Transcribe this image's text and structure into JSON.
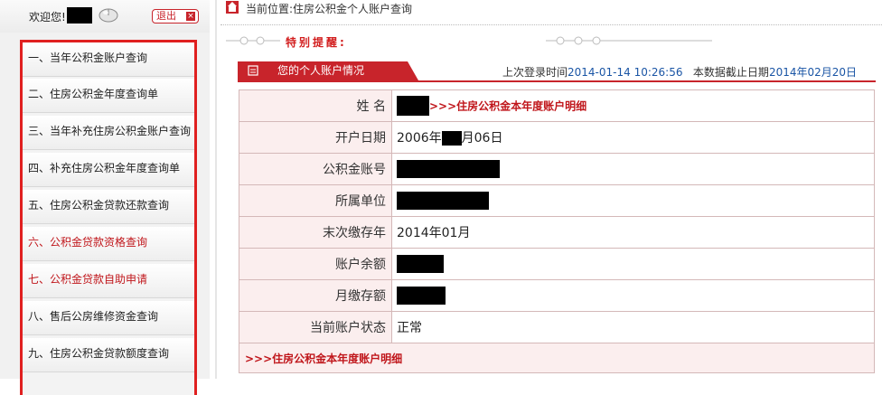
{
  "welcome": {
    "text": "欢迎您!",
    "logout_label": "退出"
  },
  "menu": [
    {
      "label": "一、当年公积金账户查询",
      "highlight": false
    },
    {
      "label": "二、住房公积金年度查询单",
      "highlight": false
    },
    {
      "label": "三、当年补充住房公积金账户查询",
      "highlight": false
    },
    {
      "label": "四、补充住房公积金年度查询单",
      "highlight": false
    },
    {
      "label": "五、住房公积金贷款还款查询",
      "highlight": false
    },
    {
      "label": "六、公积金贷款资格查询",
      "highlight": true
    },
    {
      "label": "七、公积金贷款自助申请",
      "highlight": true
    },
    {
      "label": "八、售后公房维修资金查询",
      "highlight": false
    },
    {
      "label": "九、住房公积金贷款额度查询",
      "highlight": false
    }
  ],
  "breadcrumb": "当前位置:住房公积金个人账户查询",
  "notice_title": "特别提醒:",
  "section_tab": "您的个人账户情况",
  "login_info": {
    "last_login_label": "上次登录时间",
    "last_login_value": "2014-01-14 10:26:56",
    "cutoff_label": "本数据截止日期",
    "cutoff_value": "2014年02月20日"
  },
  "account": {
    "name_label": "姓 名",
    "detail_link": ">>>住房公积金本年度账户明细",
    "open_date_label": "开户日期",
    "open_date_prefix": "2006年",
    "open_date_suffix": "月06日",
    "account_no_label": "公积金账号",
    "employer_label": "所属单位",
    "last_deposit_label": "末次缴存年",
    "last_deposit_value": "2014年01月",
    "balance_label": "账户余额",
    "monthly_label": "月缴存额",
    "status_label": "当前账户状态",
    "status_value": "正常",
    "footer_link": ">>>住房公积金本年度账户明细"
  },
  "colors": {
    "accent": "#c8242b",
    "link_red": "#c0161b",
    "date_blue": "#1a55a5",
    "label_bg": "#fbeeee"
  },
  "icons": [
    "mouse-icon",
    "close-x-icon",
    "home-icon",
    "dotted-line-decoration",
    "tab-icon"
  ]
}
